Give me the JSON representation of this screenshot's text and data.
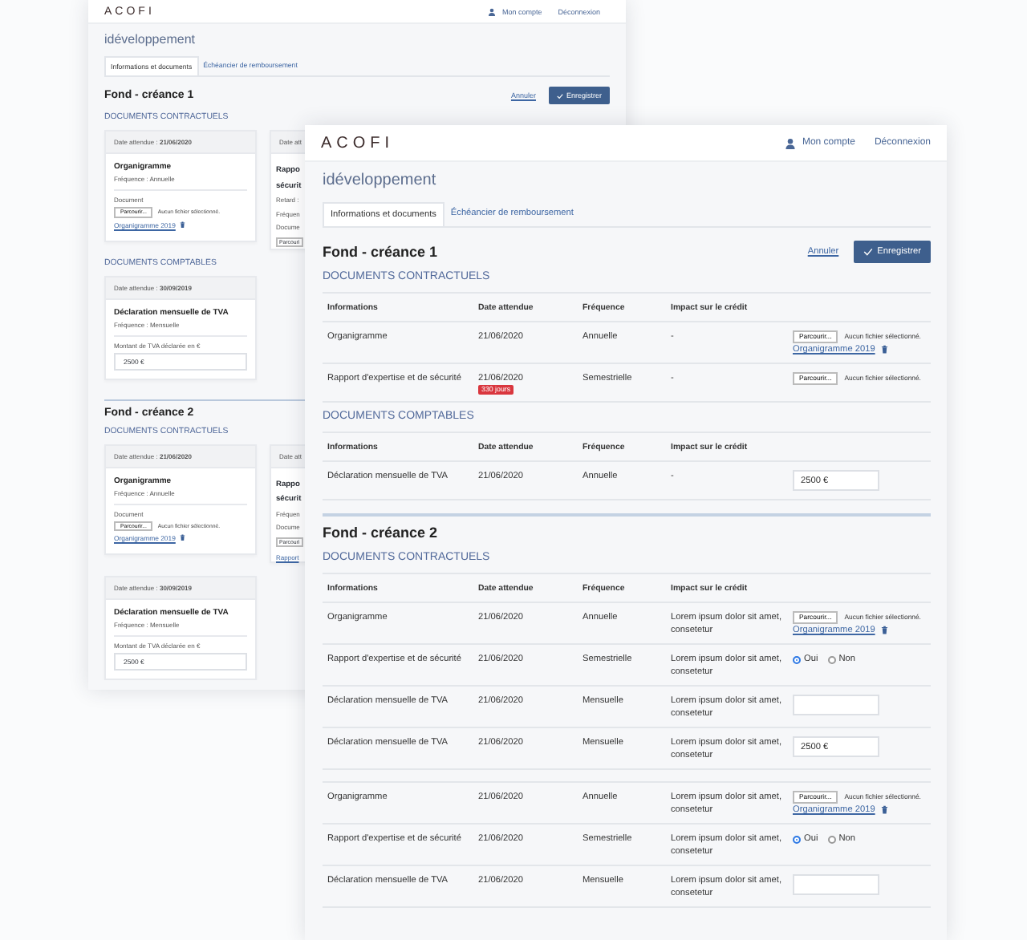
{
  "back_window": {
    "header": {
      "logo": "ACOFI",
      "account": "Mon compte",
      "logout": "Déconnexion"
    },
    "title": "idéveloppement",
    "tabs": [
      {
        "label": "Informations et documents",
        "selected": true
      },
      {
        "label": "Échéancier de remboursement",
        "selected": false
      }
    ],
    "sections": [
      {
        "heading": "Fond - créance 1",
        "cancel": "Annuler",
        "save": "Enregistrer",
        "groups": [
          {
            "label": "DOCUMENTS CONTRACTUELS",
            "cards": [
              {
                "kind": "file",
                "date_label": "Date attendue :",
                "date": "21/06/2020",
                "title": "Organigramme",
                "frequency": "Fréquence : Annuelle",
                "doc_label": "Document",
                "browse": "Parcourir...",
                "no_file": "Aucun fichier sélectionné.",
                "link": "Organigramme 2019"
              },
              {
                "kind": "partial",
                "lines": [
                  {
                    "kind": "date",
                    "text": "Date att"
                  },
                  {
                    "kind": "title",
                    "text": "Rappo"
                  },
                  {
                    "kind": "title",
                    "text": "sécurit"
                  },
                  {
                    "kind": "meta",
                    "text": "Retard :"
                  },
                  {
                    "kind": "meta",
                    "text": "Fréquen"
                  },
                  {
                    "kind": "label",
                    "text": "Docume"
                  },
                  {
                    "kind": "button",
                    "text": "Parcouri"
                  }
                ]
              }
            ]
          },
          {
            "label": "DOCUMENTS COMPTABLES",
            "cards": [
              {
                "kind": "amount",
                "date_label": "Date attendue :",
                "date": "30/09/2019",
                "title": "Déclaration mensuelle de TVA",
                "frequency": "Fréquence : Mensuelle",
                "amount_label": "Montant de TVA déclarée en €",
                "value": "2500 €"
              }
            ]
          }
        ]
      },
      {
        "heading": "Fond - créance 2",
        "groups": [
          {
            "label": "DOCUMENTS CONTRACTUELS",
            "cards": [
              {
                "kind": "file",
                "date_label": "Date attendue :",
                "date": "21/06/2020",
                "title": "Organigramme",
                "frequency": "Fréquence : Annuelle",
                "doc_label": "Document",
                "browse": "Parcourir...",
                "no_file": "Aucun fichier sélectionné.",
                "link": "Organigramme 2019"
              },
              {
                "kind": "partial",
                "lines": [
                  {
                    "kind": "date",
                    "text": "Date att"
                  },
                  {
                    "kind": "title",
                    "text": "Rappo"
                  },
                  {
                    "kind": "title",
                    "text": "sécurit"
                  },
                  {
                    "kind": "meta",
                    "text": "Fréquen"
                  },
                  {
                    "kind": "label",
                    "text": "Docume"
                  },
                  {
                    "kind": "button",
                    "text": "Parcouri"
                  },
                  {
                    "kind": "link",
                    "text": "Rapport"
                  }
                ]
              },
              {
                "kind": "amount",
                "date_label": "Date attendue :",
                "date": "30/09/2019",
                "title": "Déclaration mensuelle de TVA",
                "frequency": "Fréquence : Mensuelle",
                "amount_label": "Montant de TVA déclarée en €",
                "value": "2500 €"
              }
            ]
          }
        ]
      }
    ]
  },
  "front_window": {
    "header": {
      "logo": "ACOFI",
      "account": "Mon compte",
      "logout": "Déconnexion"
    },
    "title": "idéveloppement",
    "tabs": [
      {
        "label": "Informations et documents",
        "selected": true
      },
      {
        "label": "Échéancier de remboursement",
        "selected": false
      }
    ],
    "sections": [
      {
        "heading": "Fond - créance 1",
        "cancel": "Annuler",
        "save": "Enregistrer",
        "groups": [
          {
            "label": "DOCUMENTS CONTRACTUELS",
            "columns": [
              "Informations",
              "Date attendue",
              "Fréquence",
              "Impact sur le crédit"
            ],
            "row_sets": [
              [
                {
                  "info": "Organigramme",
                  "date": "21/06/2020",
                  "frequency": "Annuelle",
                  "impact": "-",
                  "kind": "file",
                  "browse": "Parcourir...",
                  "no_file": "Aucun fichier sélectionné.",
                  "link": "Organigramme 2019"
                },
                {
                  "info": "Rapport d'expertise et de sécurité",
                  "date": "21/06/2020",
                  "badge": "330 jours",
                  "frequency": "Semestrielle",
                  "impact": "-",
                  "kind": "file",
                  "browse": "Parcourir...",
                  "no_file": "Aucun fichier sélectionné."
                }
              ]
            ]
          },
          {
            "label": "DOCUMENTS COMPTABLES",
            "columns": [
              "Informations",
              "Date attendue",
              "Fréquence",
              "Impact sur le crédit"
            ],
            "row_sets": [
              [
                {
                  "info": "Déclaration mensuelle de TVA",
                  "date": "21/06/2020",
                  "frequency": "Annuelle",
                  "impact": "-",
                  "kind": "input",
                  "value": "2500 €"
                }
              ]
            ]
          }
        ]
      },
      {
        "heading": "Fond - créance 2",
        "groups": [
          {
            "label": "DOCUMENTS CONTRACTUELS",
            "columns": [
              "Informations",
              "Date attendue",
              "Fréquence",
              "Impact sur le crédit"
            ],
            "row_sets": [
              [
                {
                  "info": "Organigramme",
                  "date": "21/06/2020",
                  "frequency": "Annuelle",
                  "impact": "Lorem ipsum dolor sit amet, consetetur",
                  "kind": "file",
                  "browse": "Parcourir...",
                  "no_file": "Aucun fichier sélectionné.",
                  "link": "Organigramme 2019"
                },
                {
                  "info": "Rapport d'expertise et de sécurité",
                  "date": "21/06/2020",
                  "frequency": "Semestrielle",
                  "impact": "Lorem ipsum dolor sit amet, consetetur",
                  "kind": "radio",
                  "options": [
                    {
                      "label": "Oui",
                      "selected": true
                    },
                    {
                      "label": "Non",
                      "selected": false
                    }
                  ]
                },
                {
                  "info": "Déclaration mensuelle de TVA",
                  "date": "21/06/2020",
                  "frequency": "Mensuelle",
                  "impact": "Lorem ipsum dolor sit amet, consetetur",
                  "kind": "input"
                },
                {
                  "info": "Déclaration mensuelle de TVA",
                  "date": "21/06/2020",
                  "frequency": "Mensuelle",
                  "impact": "Lorem ipsum dolor sit amet, consetetur",
                  "kind": "input",
                  "value": "2500 €"
                }
              ],
              [
                {
                  "info": "Organigramme",
                  "date": "21/06/2020",
                  "frequency": "Annuelle",
                  "impact": "Lorem ipsum dolor sit amet, consetetur",
                  "kind": "file",
                  "browse": "Parcourir...",
                  "no_file": "Aucun fichier sélectionné.",
                  "link": "Organigramme 2019"
                },
                {
                  "info": "Rapport d'expertise et de sécurité",
                  "date": "21/06/2020",
                  "frequency": "Semestrielle",
                  "impact": "Lorem ipsum dolor sit amet, consetetur",
                  "kind": "radio",
                  "options": [
                    {
                      "label": "Oui",
                      "selected": true
                    },
                    {
                      "label": "Non",
                      "selected": false
                    }
                  ]
                },
                {
                  "info": "Déclaration mensuelle de TVA",
                  "date": "21/06/2020",
                  "frequency": "Mensuelle",
                  "impact": "Lorem ipsum dolor sit amet, consetetur",
                  "kind": "input"
                }
              ]
            ]
          }
        ]
      }
    ]
  }
}
